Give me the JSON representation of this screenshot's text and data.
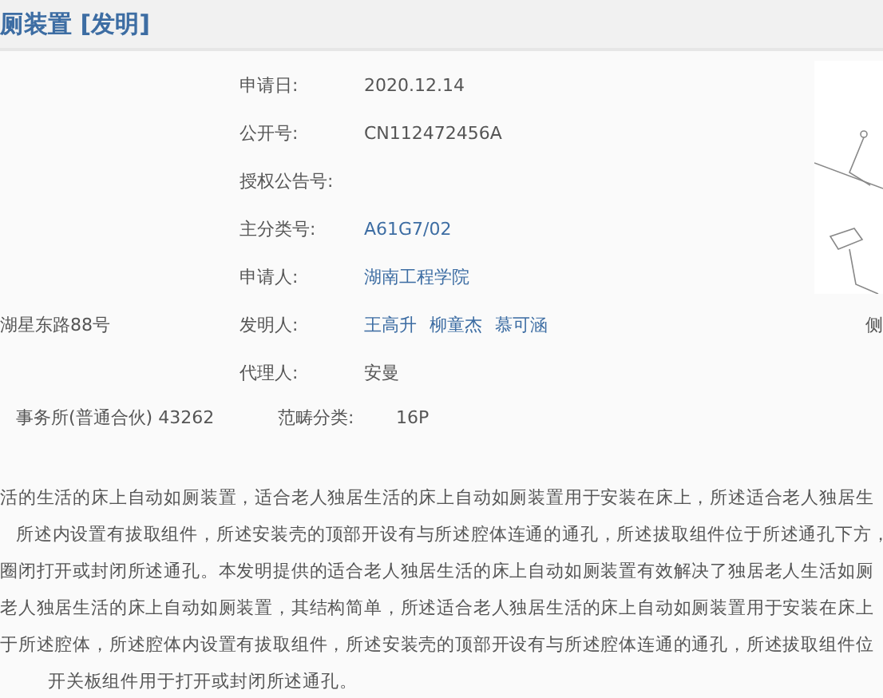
{
  "title": "厕装置 [发明]",
  "fields": [
    {
      "label": "申请日:",
      "values": [
        {
          "text": "2020.12.14",
          "kind": "plain"
        }
      ]
    },
    {
      "label": "公开号:",
      "values": [
        {
          "text": "CN112472456A",
          "kind": "plain"
        }
      ]
    },
    {
      "label": "授权公告号:"
    },
    {
      "label": "主分类号:",
      "values": [
        {
          "text": "A61G7/02",
          "kind": "link"
        }
      ]
    },
    {
      "label": "申请人:",
      "values": [
        {
          "text": "湖南工程学院",
          "kind": "link"
        }
      ]
    },
    {
      "label": "发明人:",
      "values": [
        {
          "text": "王高升",
          "kind": "link"
        },
        {
          "text": "柳童杰",
          "kind": "link"
        },
        {
          "text": "慕可涵",
          "kind": "link"
        }
      ]
    },
    {
      "label": "代理人:",
      "values": [
        {
          "text": "安曼",
          "kind": "plain"
        }
      ]
    }
  ],
  "address": "湖星东路88号",
  "agency": "事务所(普通合伙) 43262",
  "category": {
    "label": "范畴分类:",
    "value": "16P"
  },
  "edge_text": "侧",
  "abstract": [
    "活的生活的床上自动如厕装置，适合老人独居生活的床上自动如厕装置用于安装在床上，所述适合老人独居生",
    "所述内设置有拔取组件，所述安装壳的顶部开设有与所述腔体连通的通孔，所述拔取组件位于所述通孔下方，",
    "圈闭打开或封闭所述通孔。本发明提供的适合老人独居生活的床上自动如厕装置有效解决了独居老人生活如厕",
    "老人独居生活的床上自动如厕装置，其结构简单，所述适合老人独居生活的床上自动如厕装置用于安装在床上",
    "于所述腔体，所述腔体内设置有拔取组件，所述安装壳的顶部开设有与所述腔体连通的通孔，所述拔取组件位",
    "开关板组件用于打开或封闭所述通孔。"
  ]
}
